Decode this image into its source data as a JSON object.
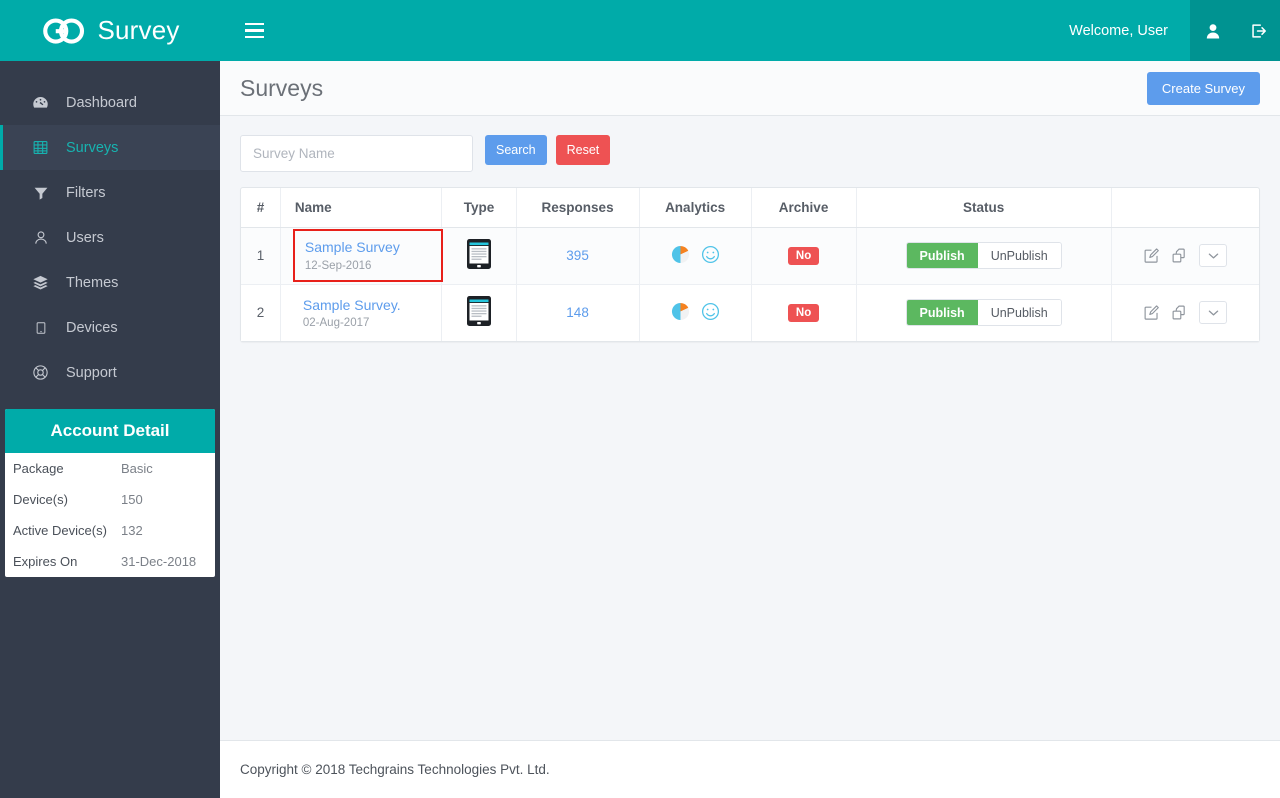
{
  "header": {
    "brand": "Survey",
    "brand_logo_icon": "go-infinity-logo",
    "menu_toggle_icon": "hamburger-icon",
    "welcome_text": "Welcome, User",
    "user_icon": "user-icon",
    "logout_icon": "logout-icon"
  },
  "sidebar": {
    "items": [
      {
        "label": "Dashboard",
        "icon": "dashboard-icon",
        "active": false
      },
      {
        "label": "Surveys",
        "icon": "book-icon",
        "active": true
      },
      {
        "label": "Filters",
        "icon": "funnel-icon",
        "active": false
      },
      {
        "label": "Users",
        "icon": "user-icon",
        "active": false
      },
      {
        "label": "Themes",
        "icon": "layers-icon",
        "active": false
      },
      {
        "label": "Devices",
        "icon": "tablet-icon",
        "active": false
      },
      {
        "label": "Support",
        "icon": "life-ring-icon",
        "active": false
      }
    ],
    "account": {
      "title": "Account Detail",
      "rows": [
        {
          "key": "Package",
          "value": "Basic"
        },
        {
          "key": "Device(s)",
          "value": "150"
        },
        {
          "key": "Active Device(s)",
          "value": "132"
        },
        {
          "key": "Expires On",
          "value": "31-Dec-2018"
        }
      ]
    }
  },
  "page": {
    "title": "Surveys",
    "create_button": "Create Survey"
  },
  "filters": {
    "search_placeholder": "Survey Name",
    "search_value": "",
    "search_button": "Search",
    "reset_button": "Reset"
  },
  "table": {
    "columns": [
      "#",
      "Name",
      "Type",
      "Responses",
      "Analytics",
      "Archive",
      "Status",
      ""
    ],
    "rows": [
      {
        "index": "1",
        "name": "Sample Survey",
        "date": "12-Sep-2016",
        "highlighted": true,
        "type_icon": "tablet-device-icon",
        "responses": "395",
        "analytics_icons": [
          "pie-chart-icon",
          "smiley-icon"
        ],
        "archive": "No",
        "status_on": "Publish",
        "status_off": "UnPublish",
        "actions": [
          "edit-icon",
          "copy-icon",
          "chevron-down-icon"
        ]
      },
      {
        "index": "2",
        "name": "Sample Survey.",
        "date": "02-Aug-2017",
        "highlighted": false,
        "type_icon": "tablet-device-icon",
        "responses": "148",
        "analytics_icons": [
          "pie-chart-icon",
          "smiley-icon"
        ],
        "archive": "No",
        "status_on": "Publish",
        "status_off": "UnPublish",
        "actions": [
          "edit-icon",
          "copy-icon",
          "chevron-down-icon"
        ]
      }
    ]
  },
  "footer": {
    "copyright": "Copyright © 2018 Techgrains Technologies Pvt. Ltd."
  },
  "colors": {
    "brand_teal": "#00aba9",
    "brand_teal_dark": "#009391",
    "sidebar_bg": "#343c4b",
    "accent_blue": "#5d9cec",
    "danger_red": "#ee5253",
    "success_green": "#5cb860",
    "highlight_red": "#e8201a"
  }
}
